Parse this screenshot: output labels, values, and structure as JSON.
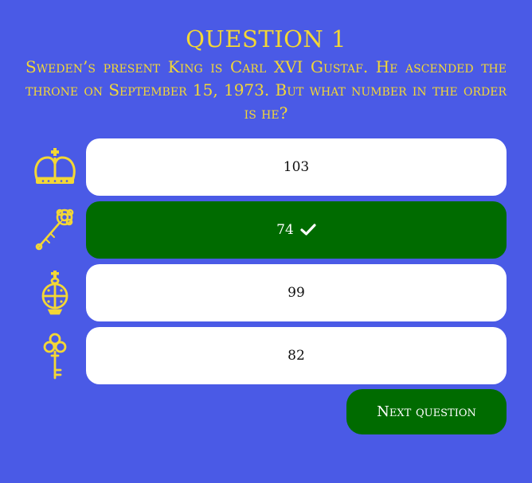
{
  "quiz": {
    "title": "QUESTION 1",
    "question": "Sweden’s present King is Carl XVI Gustaf. He ascended the throne on September 15, 1973. But what number in the order is he?",
    "answers": [
      {
        "label": "103",
        "icon": "crown-icon",
        "state": "default"
      },
      {
        "label": "74",
        "icon": "sceptre-icon",
        "state": "correct"
      },
      {
        "label": "99",
        "icon": "orb-icon",
        "state": "default"
      },
      {
        "label": "82",
        "icon": "key-icon",
        "state": "default"
      }
    ],
    "next_label": "Next question"
  },
  "colors": {
    "background": "#4a5ae6",
    "accent": "#f3d735",
    "correct": "#006b00",
    "button": "#ffffff"
  }
}
